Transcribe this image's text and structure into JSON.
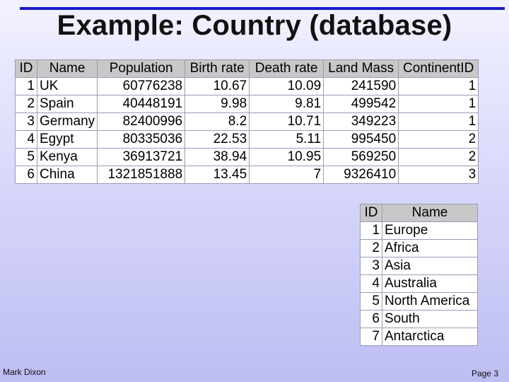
{
  "slide": {
    "title": "Example: Country (database)",
    "author": "Mark Dixon",
    "page": "Page 3"
  },
  "country_table": {
    "headers": [
      "ID",
      "Name",
      "Population",
      "Birth rate",
      "Death rate",
      "Land Mass",
      "ContinentID"
    ],
    "rows": [
      [
        "1",
        "UK",
        "60776238",
        "10.67",
        "10.09",
        "241590",
        "1"
      ],
      [
        "2",
        "Spain",
        "40448191",
        "9.98",
        "9.81",
        "499542",
        "1"
      ],
      [
        "3",
        "Germany",
        "82400996",
        "8.2",
        "10.71",
        "349223",
        "1"
      ],
      [
        "4",
        "Egypt",
        "80335036",
        "22.53",
        "5.11",
        "995450",
        "2"
      ],
      [
        "5",
        "Kenya",
        "36913721",
        "38.94",
        "10.95",
        "569250",
        "2"
      ],
      [
        "6",
        "China",
        "1321851888",
        "13.45",
        "7",
        "9326410",
        "3"
      ]
    ]
  },
  "continent_table": {
    "headers": [
      "ID",
      "Name"
    ],
    "rows": [
      [
        "1",
        "Europe"
      ],
      [
        "2",
        "Africa"
      ],
      [
        "3",
        "Asia"
      ],
      [
        "4",
        "Australia"
      ],
      [
        "5",
        "North America"
      ],
      [
        "6",
        "South"
      ],
      [
        "7",
        "Antarctica"
      ]
    ]
  }
}
